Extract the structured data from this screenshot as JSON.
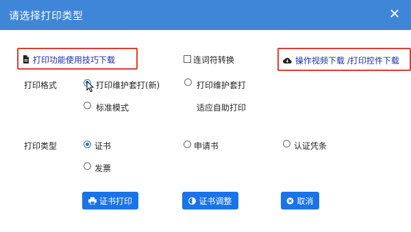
{
  "dialog": {
    "title": "请选择打印类型",
    "close_icon": "close-icon"
  },
  "links": {
    "tips": {
      "label": "打印功能使用技巧下载",
      "icon": "document-icon"
    },
    "video": {
      "label": "操作视频下载 /打印控件下载",
      "icon": "cloud-download-icon"
    }
  },
  "convert_checkbox": {
    "label": "连词符转换",
    "checked": false
  },
  "print_format": {
    "label": "打印格式",
    "options": [
      {
        "label": "打印维护套打(新)",
        "selected": true
      },
      {
        "label": "打印维护套打",
        "selected": false
      },
      {
        "label": "标准模式",
        "selected": false
      }
    ],
    "note": "适应自助打印"
  },
  "print_type": {
    "label": "打印类型",
    "options": [
      {
        "label": "证书",
        "selected": true
      },
      {
        "label": "申请书",
        "selected": false
      },
      {
        "label": "认证凭条",
        "selected": false
      },
      {
        "label": "发票",
        "selected": false
      }
    ]
  },
  "buttons": {
    "print": {
      "label": "证书打印",
      "icon": "print-icon"
    },
    "adjust": {
      "label": "证书调整",
      "icon": "adjust-icon"
    },
    "cancel": {
      "label": "取消",
      "icon": "cancel-icon"
    }
  },
  "colors": {
    "title_bar": "#3f86d8",
    "button": "#1a73e8",
    "highlight": "#e23a2c",
    "link": "#1a2fa8"
  }
}
